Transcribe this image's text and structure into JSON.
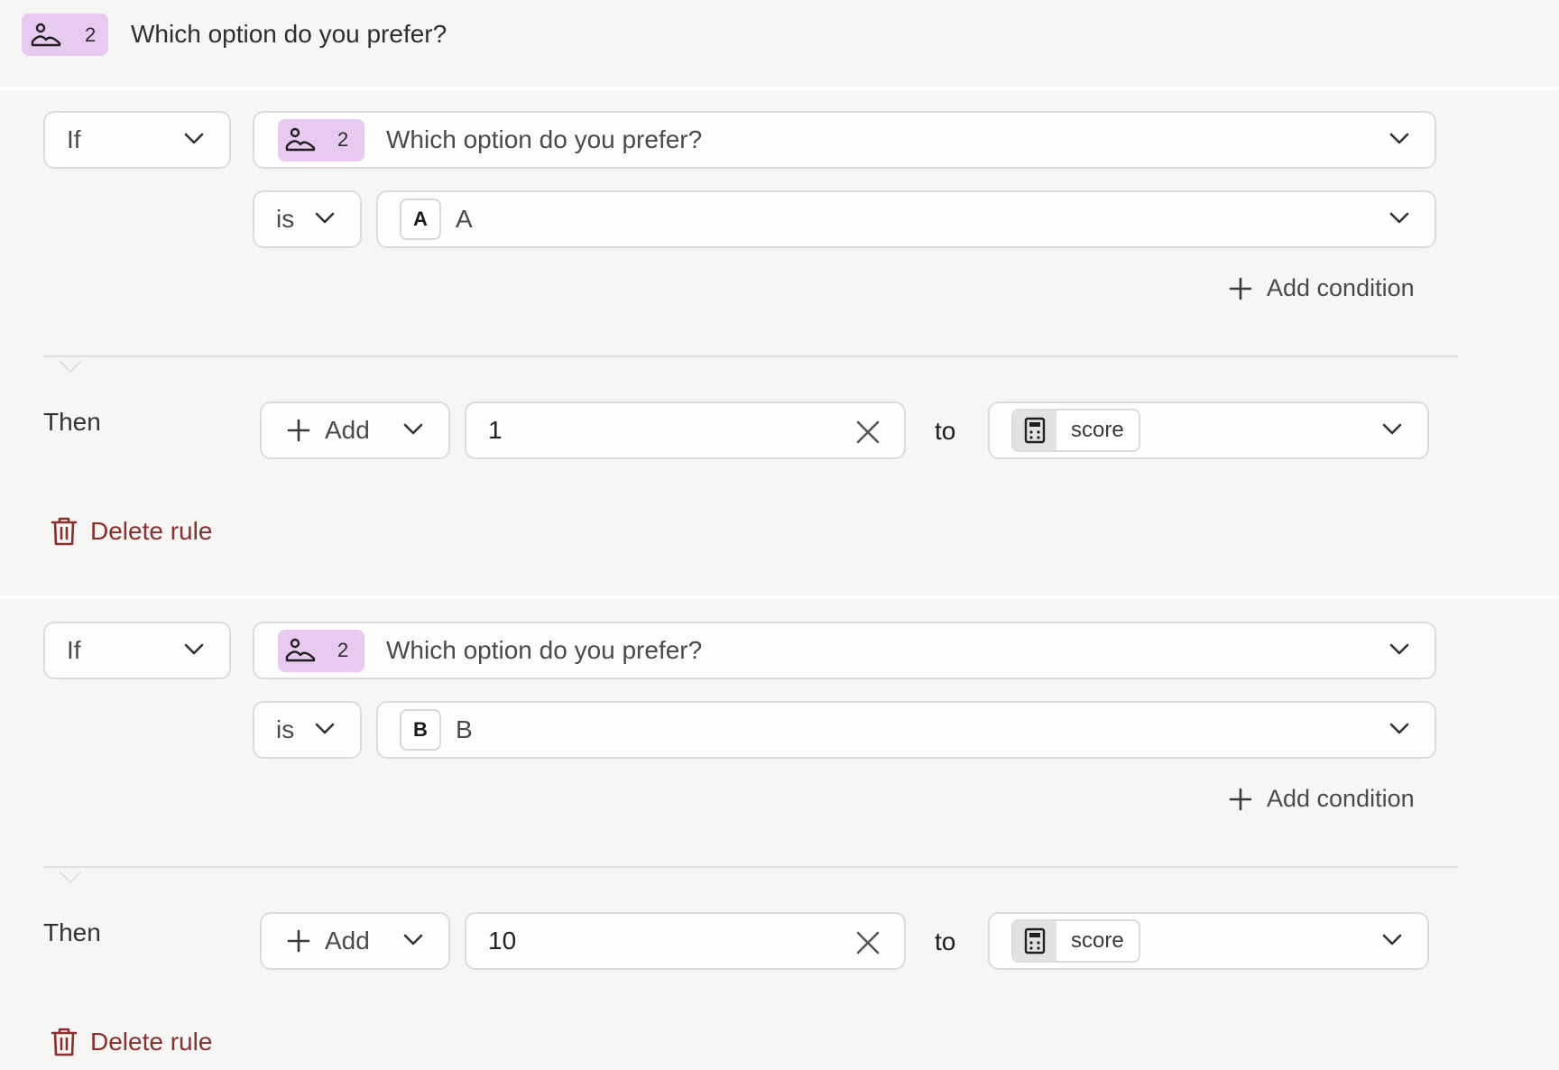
{
  "header": {
    "badge_number": "2",
    "question": "Which option do you prefer?"
  },
  "colors": {
    "badge": "#e8c9f0",
    "delete": "#8b2e2e",
    "background": "#f6f6f5"
  },
  "rules": [
    {
      "if_label": "If",
      "question_badge_number": "2",
      "question": "Which option do you prefer?",
      "operator": "is",
      "answer_letter": "A",
      "answer_value": "A",
      "add_condition": "Add condition",
      "then_label": "Then",
      "action": "Add",
      "amount": "1",
      "to_label": "to",
      "variable": "score",
      "delete": "Delete rule"
    },
    {
      "if_label": "If",
      "question_badge_number": "2",
      "question": "Which option do you prefer?",
      "operator": "is",
      "answer_letter": "B",
      "answer_value": "B",
      "add_condition": "Add condition",
      "then_label": "Then",
      "action": "Add",
      "amount": "10",
      "to_label": "to",
      "variable": "score",
      "delete": "Delete rule"
    }
  ]
}
